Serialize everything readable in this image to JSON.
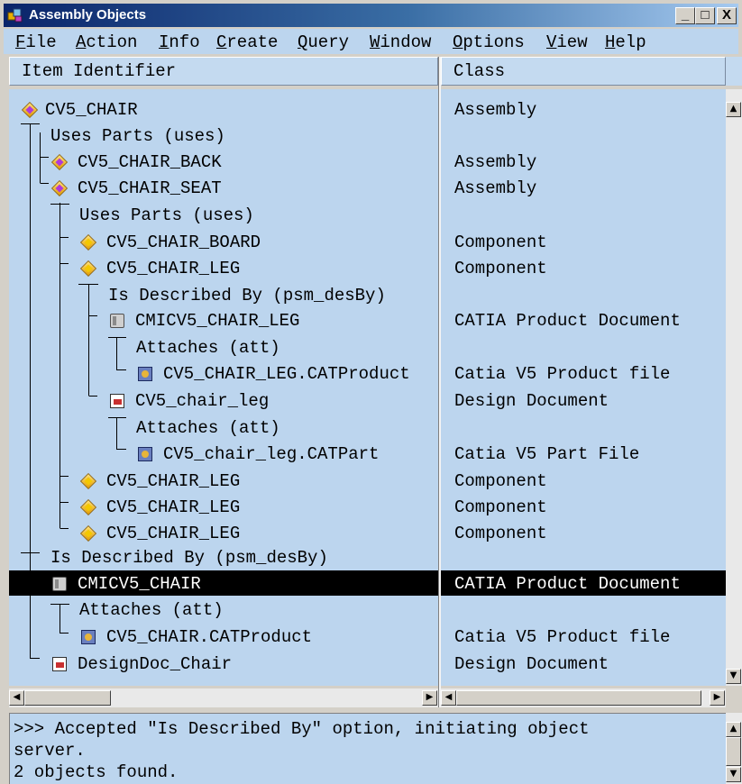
{
  "window": {
    "title": "Assembly Objects",
    "minimize_glyph": "_",
    "maximize_glyph": "□",
    "close_glyph": "X"
  },
  "menu": [
    {
      "label": "File",
      "ul": "F",
      "rest": "ile"
    },
    {
      "label": "Action",
      "ul": "A",
      "rest": "ction"
    },
    {
      "label": "Info",
      "ul": "I",
      "rest": "nfo"
    },
    {
      "label": "Create",
      "ul": "C",
      "rest": "reate"
    },
    {
      "label": "Query",
      "ul": "Q",
      "rest": "uery"
    },
    {
      "label": "Window",
      "ul": "W",
      "rest": "indow"
    },
    {
      "label": "Options",
      "ul": "O",
      "rest": "ptions"
    },
    {
      "label": "View",
      "ul": "V",
      "rest": "iew"
    },
    {
      "label": "Help",
      "ul": "H",
      "rest": "elp"
    }
  ],
  "columns": {
    "item": "Item Identifier",
    "class": "Class"
  },
  "rows": [
    {
      "label": "CV5_CHAIR",
      "icon": "assembly-icon",
      "class": "Assembly"
    },
    {
      "label": "Uses Parts (uses)",
      "icon": "",
      "class": ""
    },
    {
      "label": "CV5_CHAIR_BACK",
      "icon": "assembly-icon",
      "class": "Assembly"
    },
    {
      "label": "CV5_CHAIR_SEAT",
      "icon": "assembly-icon",
      "class": "Assembly"
    },
    {
      "label": "Uses Parts (uses)",
      "icon": "",
      "class": ""
    },
    {
      "label": "CV5_CHAIR_BOARD",
      "icon": "component-icon",
      "class": "Component"
    },
    {
      "label": "CV5_CHAIR_LEG",
      "icon": "component-icon",
      "class": "Component"
    },
    {
      "label": "Is Described By (psm_desBy)",
      "icon": "",
      "class": ""
    },
    {
      "label": "CMICV5_CHAIR_LEG",
      "icon": "product-document-icon",
      "class": "CATIA Product Document"
    },
    {
      "label": "Attaches (att)",
      "icon": "",
      "class": ""
    },
    {
      "label": "CV5_CHAIR_LEG.CATProduct",
      "icon": "catia-file-icon",
      "class": "Catia V5 Product file"
    },
    {
      "label": "CV5_chair_leg",
      "icon": "design-document-icon",
      "class": "Design Document"
    },
    {
      "label": "Attaches (att)",
      "icon": "",
      "class": ""
    },
    {
      "label": "CV5_chair_leg.CATPart",
      "icon": "catia-file-icon",
      "class": "Catia V5 Part File"
    },
    {
      "label": "CV5_CHAIR_LEG",
      "icon": "component-icon",
      "class": "Component"
    },
    {
      "label": "CV5_CHAIR_LEG",
      "icon": "component-icon",
      "class": "Component"
    },
    {
      "label": "CV5_CHAIR_LEG",
      "icon": "component-icon",
      "class": "Component"
    },
    {
      "label": "Is Described By (psm_desBy)",
      "icon": "",
      "class": ""
    },
    {
      "label": "CMICV5_CHAIR",
      "icon": "product-document-icon",
      "class": "CATIA Product Document",
      "selected": true
    },
    {
      "label": "Attaches (att)",
      "icon": "",
      "class": ""
    },
    {
      "label": "CV5_CHAIR.CATProduct",
      "icon": "catia-file-icon",
      "class": "Catia V5 Product file"
    },
    {
      "label": "DesignDoc_Chair",
      "icon": "design-document-icon",
      "class": "Design Document"
    }
  ],
  "output": [
    ">>> Accepted \"Is Described By\" option, initiating object",
    "server.",
    "2 objects found."
  ]
}
